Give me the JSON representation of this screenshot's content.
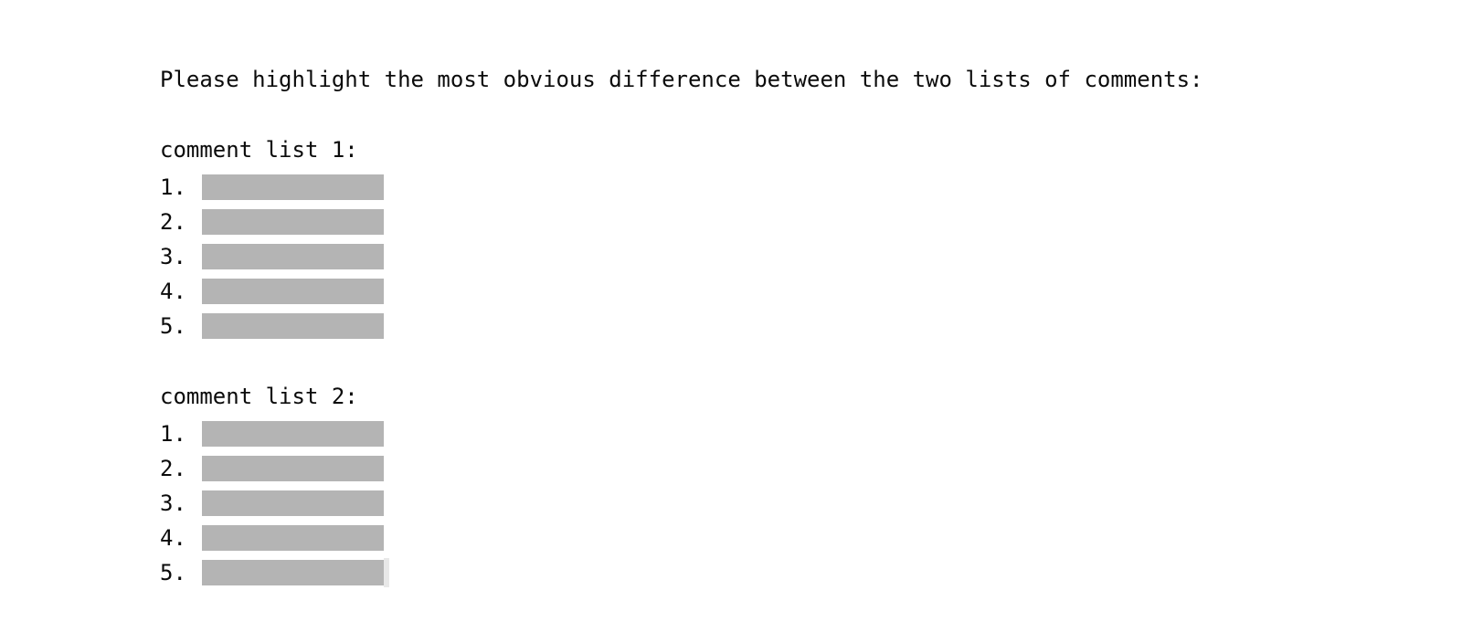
{
  "prompt": {
    "text": "Please highlight the most obvious difference between the two lists of comments:"
  },
  "colors": {
    "background": "#ffffff",
    "text": "#0b0b0b",
    "redaction_bar": "#b4b4b4",
    "selection_artifact": "#e8e8e8"
  },
  "lists": [
    {
      "title": "comment list 1:",
      "items": [
        {
          "number": "1.",
          "content": ""
        },
        {
          "number": "2.",
          "content": ""
        },
        {
          "number": "3.",
          "content": ""
        },
        {
          "number": "4.",
          "content": ""
        },
        {
          "number": "5.",
          "content": ""
        }
      ]
    },
    {
      "title": "comment list 2:",
      "items": [
        {
          "number": "1.",
          "content": ""
        },
        {
          "number": "2.",
          "content": ""
        },
        {
          "number": "3.",
          "content": ""
        },
        {
          "number": "4.",
          "content": ""
        },
        {
          "number": "5.",
          "content": ""
        }
      ]
    }
  ]
}
